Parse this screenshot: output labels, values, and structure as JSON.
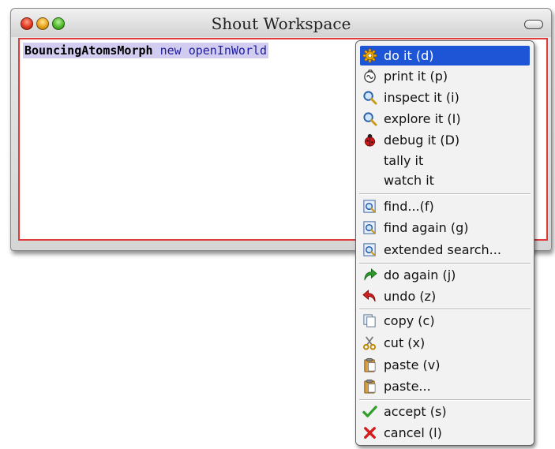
{
  "window": {
    "title": "Shout Workspace",
    "code": {
      "class_name": "BouncingAtomsMorph",
      "message": " new openInWorld"
    }
  },
  "menu": {
    "items": [
      {
        "label": "do it (d)",
        "icon": "gear-icon",
        "selected": true
      },
      {
        "label": "print it (p)",
        "icon": "print-icon"
      },
      {
        "label": "inspect it (i)",
        "icon": "magnifier-icon"
      },
      {
        "label": "explore it (I)",
        "icon": "magnifier-icon"
      },
      {
        "label": "debug it (D)",
        "icon": "ladybug-icon"
      },
      {
        "label": "tally it",
        "icon": ""
      },
      {
        "label": "watch it",
        "icon": ""
      },
      {
        "label": "find...(f)",
        "icon": "find-icon"
      },
      {
        "label": "find again (g)",
        "icon": "find-icon"
      },
      {
        "label": "extended search...",
        "icon": "find-icon"
      },
      {
        "label": "do again (j)",
        "icon": "redo-arrow-icon"
      },
      {
        "label": "undo (z)",
        "icon": "undo-arrow-icon"
      },
      {
        "label": "copy (c)",
        "icon": "copy-icon"
      },
      {
        "label": "cut (x)",
        "icon": "scissors-icon"
      },
      {
        "label": "paste (v)",
        "icon": "clipboard-icon"
      },
      {
        "label": "paste...",
        "icon": "clipboard-icon"
      },
      {
        "label": "accept (s)",
        "icon": "checkmark-icon"
      },
      {
        "label": "cancel (l)",
        "icon": "cross-icon"
      }
    ]
  },
  "colors": {
    "selection": "#1e54d6",
    "code_highlight": "#d2ccf0",
    "pane_border": "#e03a3a"
  }
}
